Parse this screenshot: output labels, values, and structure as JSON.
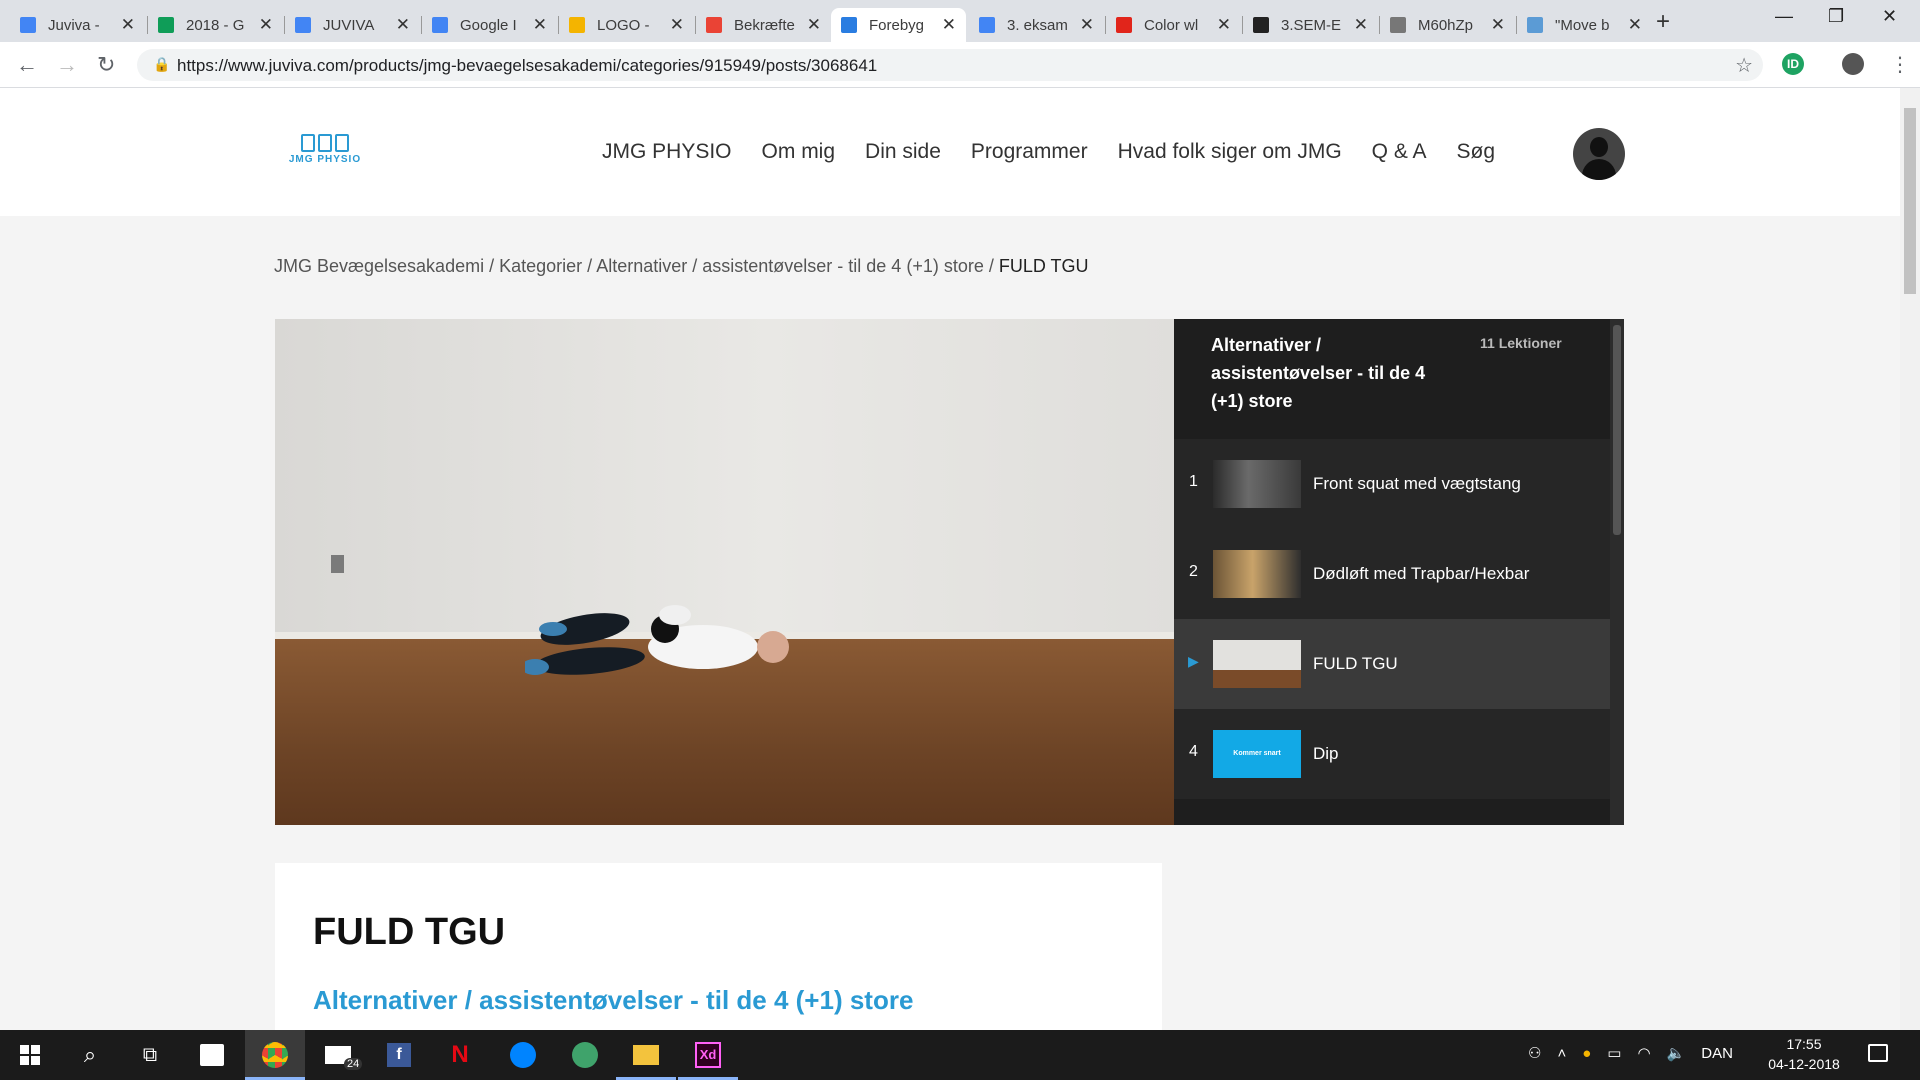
{
  "browser": {
    "tabs": [
      {
        "title": "Juviva -",
        "color": "#4285f4",
        "icon": "docs-icon"
      },
      {
        "title": "2018 - G",
        "color": "#0f9d58",
        "icon": "sheets-icon"
      },
      {
        "title": "JUVIVA",
        "color": "#4285f4",
        "icon": "docs-icon"
      },
      {
        "title": "Google I",
        "color": "#4285f4",
        "icon": "calendar-icon"
      },
      {
        "title": "LOGO -",
        "color": "#f4b400",
        "icon": "drive-icon"
      },
      {
        "title": "Bekræfte",
        "color": "#ea4335",
        "icon": "gmail-icon"
      },
      {
        "title": "Forebyg",
        "color": "#2a7de1",
        "icon": "juviva-icon",
        "active": true
      },
      {
        "title": "3. eksam",
        "color": "#4285f4",
        "icon": "docs-icon"
      },
      {
        "title": "Color wl",
        "color": "#e1251b",
        "icon": "adobe-icon"
      },
      {
        "title": "3.SEM-E",
        "color": "#222222",
        "icon": "page-icon"
      },
      {
        "title": "M60hZp",
        "color": "#777777",
        "icon": "file-icon"
      },
      {
        "title": "\"Move b",
        "color": "#5b9bd5",
        "icon": "doc-icon"
      }
    ],
    "new_tab": "+",
    "url": "https://www.juviva.com/products/jmg-bevaegelsesakademi/categories/915949/posts/3068641"
  },
  "site": {
    "logo_text": "JMG PHYSIO",
    "nav": [
      "JMG PHYSIO",
      "Om mig",
      "Din side",
      "Programmer",
      "Hvad folk siger om JMG",
      "Q & A",
      "Søg"
    ]
  },
  "breadcrumb": {
    "items": [
      "JMG Bevægelsesakademi",
      "Kategorier",
      "Alternativer",
      "assistentøvelser - til de 4 (+1) store"
    ],
    "current": "FULD TGU",
    "sep": " / "
  },
  "playlist": {
    "title": "Alternativer / assistentøvelser - til de 4 (+1) store",
    "count": "11 Lektioner",
    "items": [
      {
        "num": "1",
        "label": "Front squat med vægtstang"
      },
      {
        "num": "2",
        "label": "Dødløft med Trapbar/Hexbar"
      },
      {
        "num": "",
        "label": "FULD TGU",
        "active": true
      },
      {
        "num": "4",
        "label": "Dip",
        "thumb_text": "Kommer snart"
      }
    ]
  },
  "post": {
    "title": "FULD TGU",
    "category": "Alternativer / assistentøvelser - til de 4 (+1) store"
  },
  "taskbar": {
    "language": "DAN",
    "time": "17:55",
    "date": "04-12-2018",
    "mail_badge": "24"
  }
}
